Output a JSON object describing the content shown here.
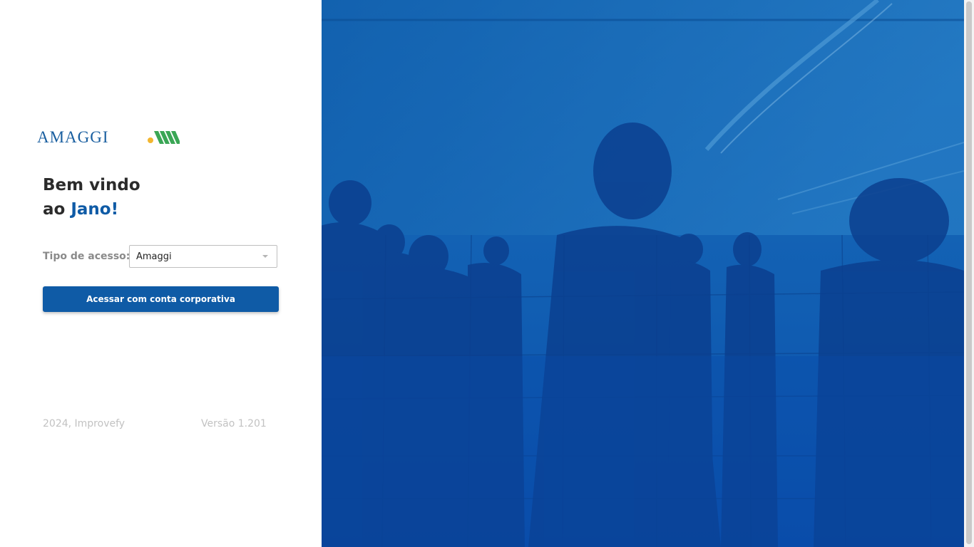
{
  "brand": {
    "logo_text": "AMAGGI",
    "logo_dot_color": "#f2b630",
    "logo_stripes_color": "#3aa655",
    "primary_color": "#0f5ba6"
  },
  "welcome": {
    "line1": "Bem vindo",
    "line2_prefix": "ao ",
    "line2_highlight": "Jano!"
  },
  "access": {
    "label": "Tipo de acesso:",
    "selected": "Amaggi"
  },
  "login_button": {
    "label": "Acessar com conta corporativa"
  },
  "footer": {
    "copyright": "2024, Improvefy",
    "version": "Versão 1.201"
  },
  "hero": {
    "description_icon": "business-people-silhouette-image"
  }
}
